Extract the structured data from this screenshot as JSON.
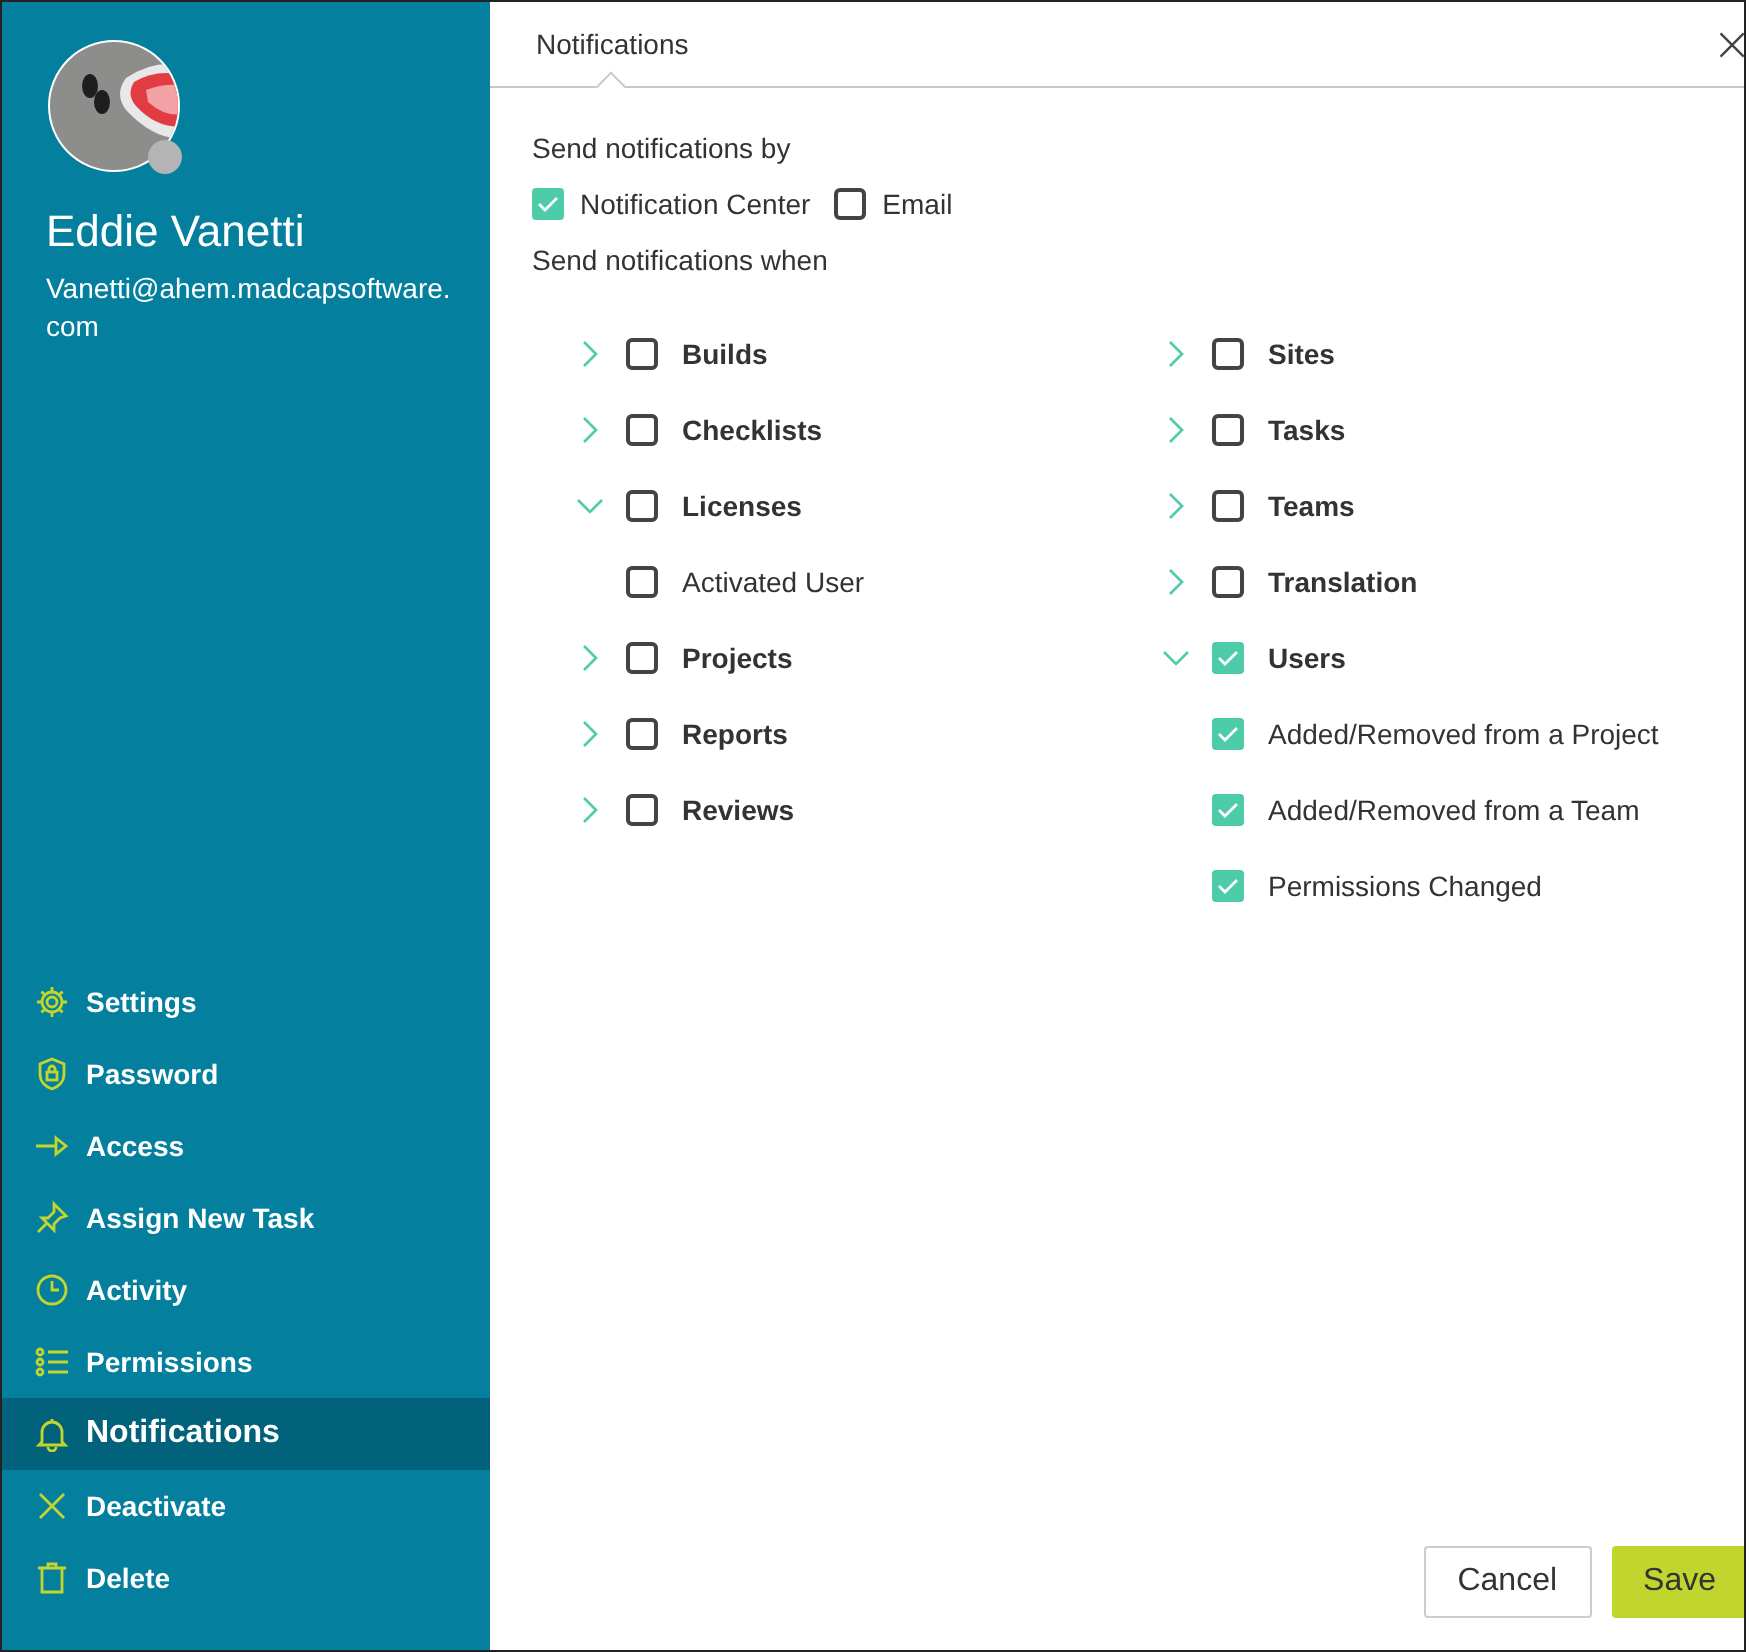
{
  "user": {
    "name": "Eddie Vanetti",
    "email": "Vanetti@ahem.madcapsoftware.com",
    "online": false
  },
  "menu": [
    {
      "label": "Settings",
      "selected": false
    },
    {
      "label": "Password",
      "selected": false
    },
    {
      "label": "Access",
      "selected": false
    },
    {
      "label": "Assign New Task",
      "selected": false
    },
    {
      "label": "Activity",
      "selected": false
    },
    {
      "label": "Permissions",
      "selected": false
    },
    {
      "label": "Notifications",
      "selected": true
    },
    {
      "label": "Deactivate",
      "selected": false
    },
    {
      "label": "Delete",
      "selected": false
    }
  ],
  "dialog": {
    "title": "Notifications",
    "close": "×"
  },
  "send_by": {
    "label": "Send notifications by",
    "options": [
      {
        "label": "Notification Center",
        "checked": true
      },
      {
        "label": "Email",
        "checked": false
      }
    ]
  },
  "send_when": {
    "label": "Send notifications when",
    "columns": [
      [
        {
          "label": "Builds",
          "checked": false,
          "expanded": false
        },
        {
          "label": "Checklists",
          "checked": false,
          "expanded": false
        },
        {
          "label": "Licenses",
          "checked": false,
          "expanded": true,
          "children": [
            {
              "label": "Activated User",
              "checked": false
            }
          ]
        },
        {
          "label": "Projects",
          "checked": false,
          "expanded": false
        },
        {
          "label": "Reports",
          "checked": false,
          "expanded": false
        },
        {
          "label": "Reviews",
          "checked": false,
          "expanded": false
        }
      ],
      [
        {
          "label": "Sites",
          "checked": false,
          "expanded": false
        },
        {
          "label": "Tasks",
          "checked": false,
          "expanded": false
        },
        {
          "label": "Teams",
          "checked": false,
          "expanded": false
        },
        {
          "label": "Translation",
          "checked": false,
          "expanded": false
        },
        {
          "label": "Users",
          "checked": true,
          "expanded": true,
          "children": [
            {
              "label": "Added/Removed from a Project",
              "checked": true
            },
            {
              "label": "Added/Removed from a Team",
              "checked": true
            },
            {
              "label": "Permissions Changed",
              "checked": true
            }
          ]
        }
      ]
    ]
  },
  "buttons": [
    {
      "label": "Cancel",
      "kind": "secondary"
    },
    {
      "label": "Save",
      "kind": "primary"
    }
  ]
}
